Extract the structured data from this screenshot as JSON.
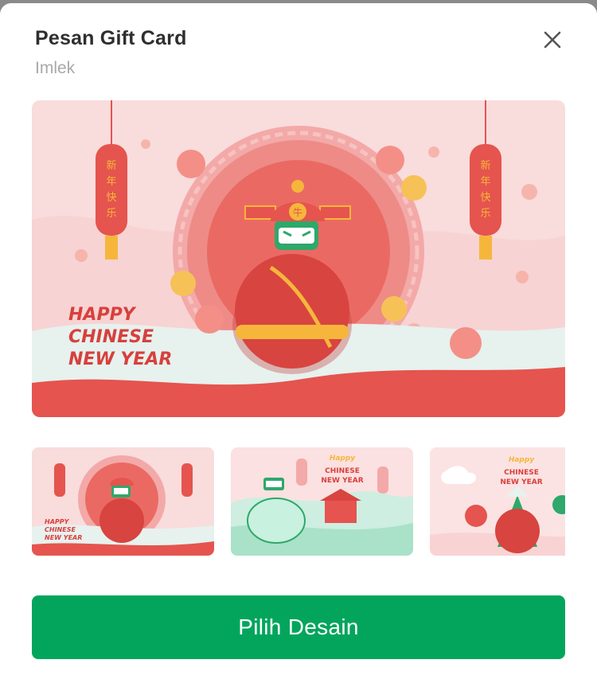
{
  "modal": {
    "title": "Pesan Gift Card",
    "subtitle": "Imlek",
    "close_icon": "close-icon"
  },
  "hero_card": {
    "greeting_lines": [
      "HAPPY",
      "CHINESE",
      "NEW YEAR"
    ],
    "lantern_text": [
      "新",
      "年",
      "快",
      "乐"
    ],
    "hat_glyph": "牛",
    "colors": {
      "background": "#f9dcdc",
      "accent": "#e5544e",
      "gold": "#f6b63b",
      "mascot_face": "#2ea86b"
    }
  },
  "designs": [
    {
      "id": "design-1",
      "greeting_lines": [
        "HAPPY",
        "CHINESE",
        "NEW YEAR"
      ],
      "selected": true
    },
    {
      "id": "design-2",
      "greeting_lines": [
        "Happy",
        "CHINESE",
        "NEW YEAR"
      ],
      "selected": false
    },
    {
      "id": "design-3",
      "greeting_lines": [
        "Happy",
        "CHINESE",
        "NEW YEAR"
      ],
      "selected": false
    }
  ],
  "actions": {
    "choose_design_label": "Pilih Desain",
    "primary_color": "#03a55d"
  }
}
